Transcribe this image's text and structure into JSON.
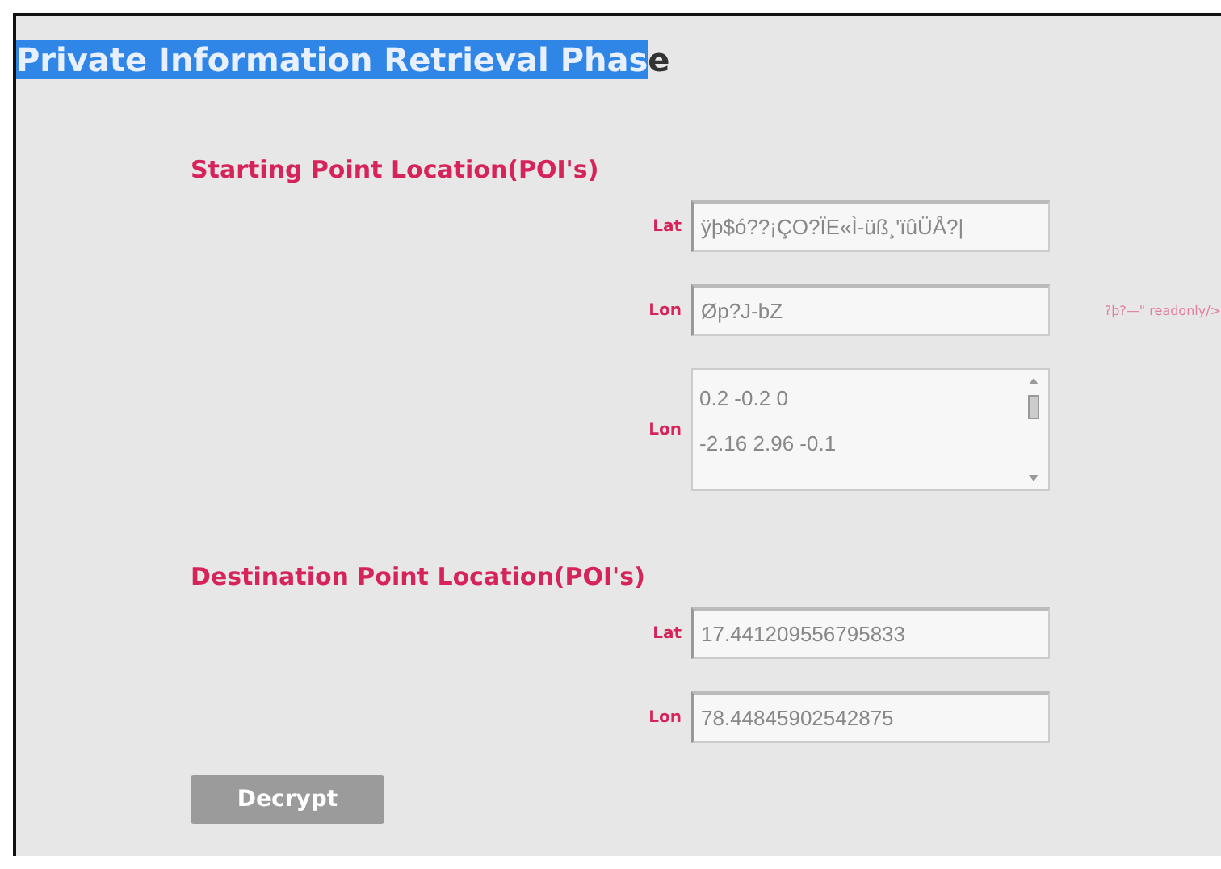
{
  "title": {
    "selected": "Private Information Retrieval Phas",
    "rest": "e"
  },
  "sections": [
    {
      "heading": "Starting Point Location(POI's)",
      "fields": [
        {
          "kind": "input",
          "label": "Lat",
          "value": "ÿþ$ó??¡ÇO?ÏE«Ì-üß¸'ïûÜÅ?|"
        },
        {
          "kind": "input",
          "label": "Lon",
          "value": "Øp?J-bZ",
          "trailing": "?þ?—\" readonly/>"
        },
        {
          "kind": "textarea",
          "label": "Lon",
          "value": "0.2 -0.2 0\n-2.16 2.96 -0.1"
        }
      ]
    },
    {
      "heading": "Destination Point Location(POI's)",
      "fields": [
        {
          "kind": "input",
          "label": "Lat",
          "value": "17.441209556795833"
        },
        {
          "kind": "input",
          "label": "Lon",
          "value": "78.44845902542875"
        }
      ]
    }
  ],
  "button": "Decrypt"
}
